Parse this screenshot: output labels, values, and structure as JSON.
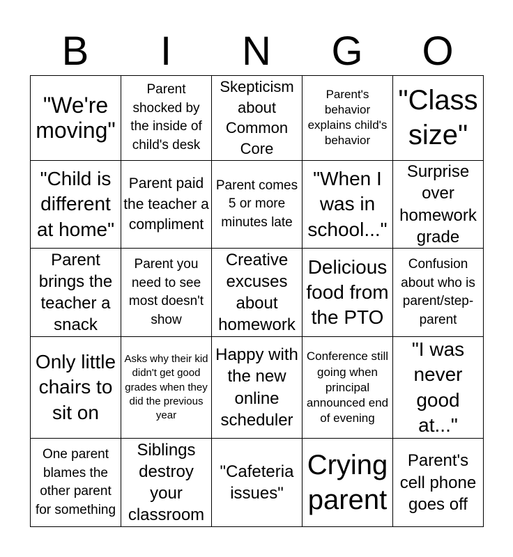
{
  "header": {
    "letters": [
      "B",
      "I",
      "N",
      "G",
      "O"
    ]
  },
  "board": {
    "rows": [
      [
        "\"We're moving\"",
        "Parent shocked by the inside of child's desk",
        "Skepticism about Common Core",
        "Parent's behavior explains child's behavior",
        "\"Class size\""
      ],
      [
        "\"Child is different at home\"",
        "Parent paid the teacher a compliment",
        "Parent comes 5 or more minutes late",
        "\"When I was in school...\"",
        "Surprise over homework grade"
      ],
      [
        "Parent brings the teacher a snack",
        "Parent you need to see most doesn't show",
        "Creative excuses about homework",
        "Delicious food from the PTO",
        "Confusion about who is parent/step-parent"
      ],
      [
        "Only little chairs to sit on",
        "Asks why their kid didn't get good grades when they did the previous year",
        "Happy with the new online scheduler",
        "Conference still going when principal announced end of evening",
        "\"I was never good at...\""
      ],
      [
        "One parent blames the other parent for something",
        "Siblings destroy your classroom",
        "\"Cafeteria issues\"",
        "Crying parent",
        "Parent's cell phone goes off"
      ]
    ]
  }
}
